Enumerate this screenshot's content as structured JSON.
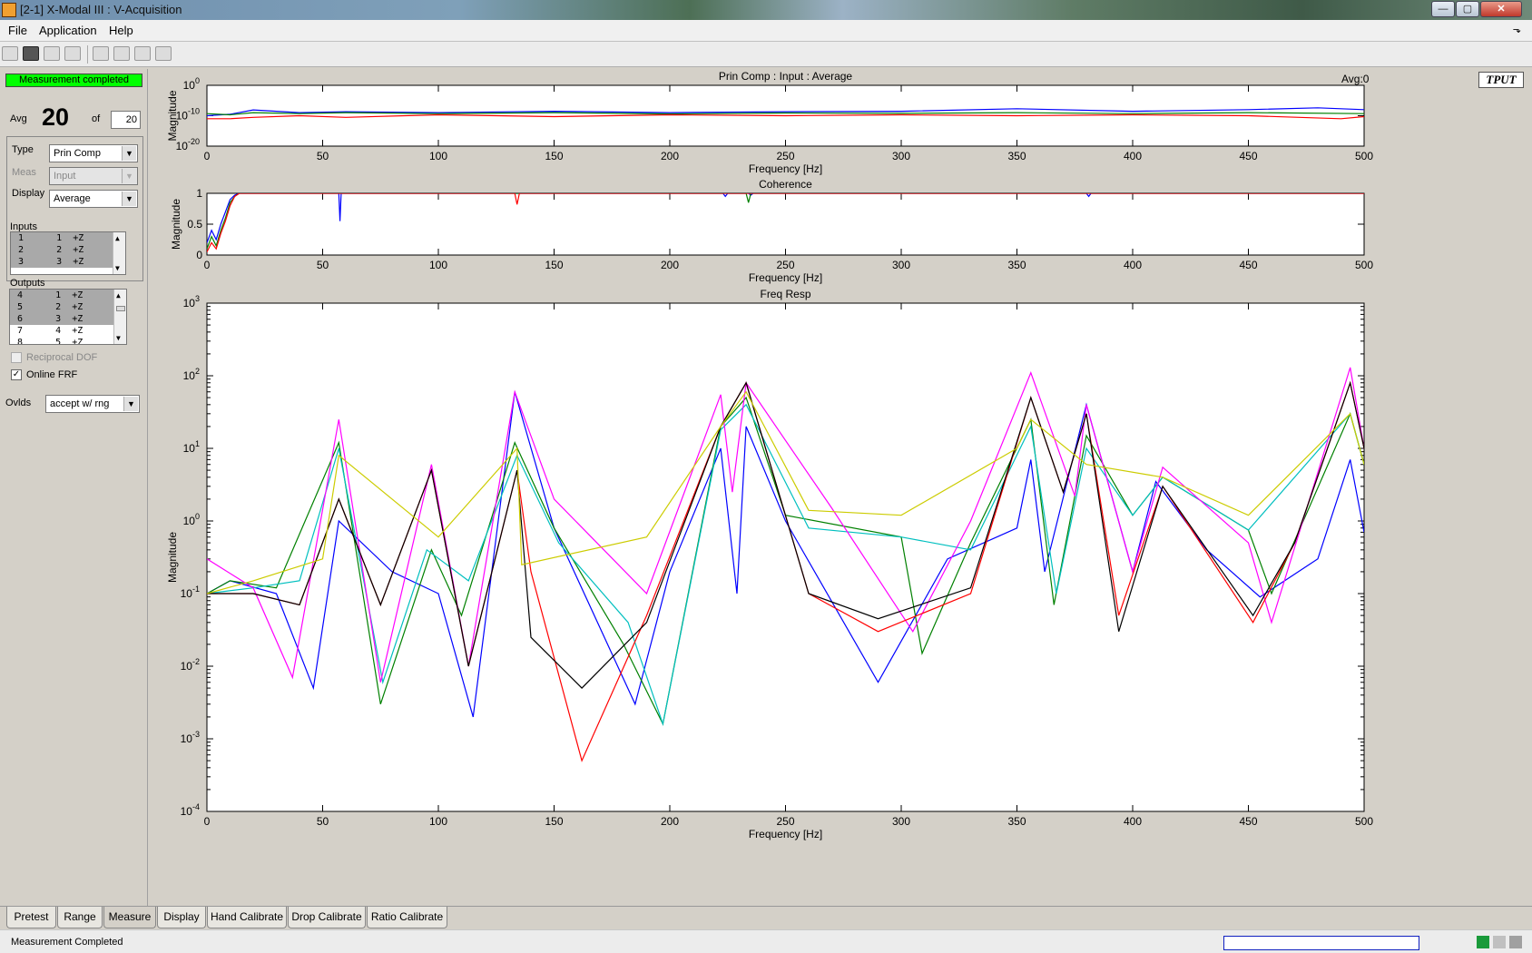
{
  "window": {
    "title": "[2-1] X-Modal III : V-Acquisition",
    "minimize": "—",
    "maximize": "▢",
    "close": "✕"
  },
  "menu": {
    "items": [
      "File",
      "Application",
      "Help"
    ],
    "arrow": "⬎"
  },
  "left": {
    "status": "Measurement completed",
    "avg_label": "Avg",
    "avg_value": "20",
    "of_label": "of",
    "avg_total": "20",
    "type_label": "Type",
    "type_value": "Prin Comp",
    "meas_label": "Meas",
    "meas_value": "Input",
    "display_label": "Display",
    "display_value": "Average",
    "inputs_label": "Inputs",
    "inputs": [
      "1      1  +Z",
      "2      2  +Z",
      "3      3  +Z"
    ],
    "outputs_label": "Outputs",
    "outputs": [
      "4      1  +Z",
      "5      2  +Z",
      "6      3  +Z",
      "7      4  +Z",
      "8      5  +Z"
    ],
    "reciprocal_label": "Reciprocal DOF",
    "online_frf_label": "Online FRF",
    "online_frf_check": "✓",
    "ovlds_label": "Ovlds",
    "ovlds_value": "accept w/ rng"
  },
  "plots": {
    "header_title": "Prin Comp : Input : Average",
    "avg_counter": "Avg:0",
    "tput_label": "TPUT"
  },
  "chart_data": [
    {
      "type": "line",
      "title": "Prin Comp : Input : Average",
      "xlabel": "Frequency [Hz]",
      "ylabel": "Magnitude",
      "xlim": [
        0,
        500
      ],
      "ylim": [
        1e-20,
        1
      ],
      "yscale": "log",
      "xticks": [
        0,
        50,
        100,
        150,
        200,
        250,
        300,
        350,
        400,
        450,
        500
      ],
      "ytick_labels": [
        {
          "base": "10",
          "exp": "0",
          "value": 1
        },
        {
          "base": "10",
          "exp": "-10",
          "value": 1e-10
        },
        {
          "base": "10",
          "exp": "-20",
          "value": 1e-20
        }
      ],
      "series": [
        {
          "color": "#0000ff",
          "x": [
            0,
            10,
            20,
            40,
            60,
            100,
            150,
            200,
            250,
            300,
            350,
            400,
            450,
            480,
            500
          ],
          "y": [
            1e-10,
            3e-10,
            8e-09,
            1e-09,
            2e-09,
            1e-09,
            3e-09,
            1e-09,
            2e-09,
            3e-09,
            2e-08,
            3e-09,
            1e-08,
            4e-08,
            1e-08
          ]
        },
        {
          "color": "#008000",
          "x": [
            0,
            10,
            20,
            40,
            60,
            100,
            150,
            200,
            250,
            300,
            350,
            400,
            450,
            500
          ],
          "y": [
            5e-10,
            2e-10,
            1e-09,
            5e-10,
            1e-09,
            5e-10,
            1e-09,
            4e-10,
            8e-10,
            6e-10,
            1e-09,
            5e-10,
            1e-09,
            5e-10
          ]
        },
        {
          "color": "#ff0000",
          "x": [
            0,
            10,
            20,
            40,
            60,
            100,
            150,
            200,
            250,
            300,
            350,
            400,
            450,
            490,
            500
          ],
          "y": [
            1e-11,
            1e-11,
            3e-11,
            1e-10,
            3e-11,
            2e-10,
            5e-11,
            2e-10,
            1e-10,
            2e-10,
            1e-10,
            2e-10,
            1e-10,
            1e-11,
            5e-11
          ]
        }
      ]
    },
    {
      "type": "line",
      "title": "Coherence",
      "xlabel": "Frequency [Hz]",
      "ylabel": "Magnitude",
      "xlim": [
        0,
        500
      ],
      "ylim": [
        0,
        1
      ],
      "xticks": [
        0,
        50,
        100,
        150,
        200,
        250,
        300,
        350,
        400,
        450,
        500
      ],
      "yticks": [
        "0",
        "0.5",
        "1"
      ],
      "series": [
        {
          "color": "#0000ff",
          "x": [
            0,
            2,
            4,
            6,
            8,
            10,
            12,
            14,
            57,
            57.5,
            58,
            100,
            223,
            224,
            225,
            234,
            235,
            236,
            380,
            381,
            382,
            500
          ],
          "y": [
            0.2,
            0.4,
            0.25,
            0.5,
            0.7,
            0.9,
            0.97,
            1,
            1,
            0.55,
            1,
            1,
            1,
            0.95,
            1,
            1,
            0.97,
            1,
            1,
            0.95,
            1,
            1
          ]
        },
        {
          "color": "#008000",
          "x": [
            0,
            2,
            4,
            6,
            8,
            10,
            12,
            14,
            100,
            233,
            234,
            235,
            500
          ],
          "y": [
            0.1,
            0.3,
            0.15,
            0.4,
            0.6,
            0.85,
            0.95,
            1,
            1,
            1,
            0.85,
            1,
            1
          ]
        },
        {
          "color": "#ff0000",
          "x": [
            0,
            2,
            4,
            6,
            8,
            10,
            12,
            14,
            133,
            134,
            135,
            500
          ],
          "y": [
            0.05,
            0.2,
            0.1,
            0.35,
            0.55,
            0.8,
            0.95,
            1,
            1,
            0.82,
            1,
            1
          ]
        }
      ]
    },
    {
      "type": "line",
      "title": "Freq Resp",
      "xlabel": "Frequency [Hz]",
      "ylabel": "Magnitude",
      "xlim": [
        0,
        500
      ],
      "ylim": [
        0.0001,
        1000
      ],
      "yscale": "log",
      "xticks": [
        0,
        50,
        100,
        150,
        200,
        250,
        300,
        350,
        400,
        450,
        500
      ],
      "ytick_labels": [
        {
          "base": "10",
          "exp": "3",
          "value": 1000
        },
        {
          "base": "10",
          "exp": "2",
          "value": 100
        },
        {
          "base": "10",
          "exp": "1",
          "value": 10
        },
        {
          "base": "10",
          "exp": "0",
          "value": 1
        },
        {
          "base": "10",
          "exp": "-1",
          "value": 0.1
        },
        {
          "base": "10",
          "exp": "-2",
          "value": 0.01
        },
        {
          "base": "10",
          "exp": "-3",
          "value": 0.001
        },
        {
          "base": "10",
          "exp": "-4",
          "value": 0.0001
        }
      ],
      "series": [
        {
          "color": "#0000ff",
          "x": [
            0,
            10,
            30,
            46,
            57,
            80,
            100,
            115,
            133,
            150,
            185,
            200,
            222,
            229,
            233,
            250,
            290,
            320,
            350,
            356,
            362,
            380,
            400,
            410,
            432,
            455,
            480,
            494,
            500
          ],
          "y": [
            0.1,
            0.15,
            0.1,
            0.005,
            1.0,
            0.2,
            0.1,
            0.002,
            60,
            0.8,
            0.003,
            0.2,
            10,
            0.1,
            20,
            1.0,
            0.006,
            0.3,
            0.8,
            7,
            0.2,
            40,
            0.2,
            3.5,
            0.4,
            0.09,
            0.3,
            7,
            0.7
          ]
        },
        {
          "color": "#008000",
          "x": [
            0,
            10,
            30,
            57,
            75,
            97,
            110,
            133,
            150,
            180,
            197,
            222,
            233,
            250,
            300,
            309,
            330,
            356,
            366,
            380,
            400,
            413,
            450,
            460,
            494,
            500
          ],
          "y": [
            0.1,
            0.15,
            0.12,
            12,
            0.003,
            0.4,
            0.05,
            12,
            0.8,
            0.02,
            0.0016,
            20,
            50,
            1.2,
            0.6,
            0.015,
            0.5,
            25,
            0.07,
            15,
            1.2,
            4,
            0.75,
            0.1,
            30,
            6
          ]
        },
        {
          "color": "#00bfbf",
          "x": [
            0,
            20,
            40,
            57,
            76,
            95,
            113,
            134,
            152,
            182,
            197,
            222,
            233,
            260,
            300,
            330,
            356,
            367,
            380,
            400,
            413,
            450,
            494,
            500
          ],
          "y": [
            0.1,
            0.12,
            0.15,
            10,
            0.006,
            0.4,
            0.15,
            8,
            0.5,
            0.04,
            0.0016,
            18,
            40,
            0.8,
            0.6,
            0.4,
            20,
            0.1,
            10,
            1.2,
            4,
            0.75,
            30,
            6
          ]
        },
        {
          "color": "#ff00ff",
          "x": [
            0,
            20,
            37,
            57,
            75,
            97,
            113,
            133,
            150,
            190,
            222,
            227,
            233,
            270,
            305,
            330,
            356,
            375,
            380,
            400,
            413,
            450,
            460,
            494,
            500
          ],
          "y": [
            0.3,
            0.12,
            0.007,
            25,
            0.006,
            6,
            0.01,
            60,
            2.0,
            0.1,
            55,
            2.5,
            80,
            1.5,
            0.03,
            1.0,
            110,
            2.2,
            40,
            0.2,
            5.5,
            0.5,
            0.04,
            130,
            10
          ]
        },
        {
          "color": "#ff0000",
          "x": [
            0,
            20,
            40,
            57,
            75,
            97,
            113,
            134,
            140,
            162,
            190,
            222,
            233,
            260,
            290,
            330,
            356,
            370,
            380,
            394,
            413,
            452,
            470,
            494,
            500
          ],
          "y": [
            0.1,
            0.1,
            0.07,
            2.0,
            0.07,
            5,
            0.01,
            5,
            0.2,
            0.0005,
            0.05,
            20,
            80,
            0.1,
            0.03,
            0.1,
            50,
            2.5,
            30,
            0.05,
            3,
            0.04,
            0.5,
            80,
            10
          ]
        },
        {
          "color": "#000000",
          "x": [
            0,
            20,
            40,
            57,
            75,
            97,
            113,
            134,
            140,
            162,
            190,
            222,
            233,
            260,
            290,
            330,
            356,
            370,
            380,
            394,
            413,
            452,
            470,
            494,
            500
          ],
          "y": [
            0.1,
            0.1,
            0.07,
            2.0,
            0.07,
            5,
            0.01,
            5,
            0.025,
            0.005,
            0.04,
            20,
            80,
            0.1,
            0.045,
            0.12,
            50,
            2.5,
            30,
            0.03,
            3,
            0.05,
            0.5,
            80,
            10
          ]
        },
        {
          "color": "#cccc00",
          "x": [
            0,
            20,
            50,
            57,
            100,
            134,
            136,
            190,
            222,
            233,
            260,
            300,
            350,
            356,
            380,
            413,
            450,
            494,
            500
          ],
          "y": [
            0.1,
            0.15,
            0.3,
            8,
            0.6,
            10,
            0.25,
            0.6,
            20,
            60,
            1.4,
            1.2,
            10,
            25,
            6,
            4,
            1.2,
            30,
            6
          ]
        }
      ]
    }
  ],
  "tabs": [
    "Pretest",
    "Range",
    "Measure",
    "Display",
    "Hand Calibrate",
    "Drop Calibrate",
    "Ratio Calibrate"
  ],
  "status_bar": {
    "text": "Measurement Completed"
  },
  "colors": {
    "status_ok": "#00ff00",
    "progress_border": "#1020c0"
  }
}
